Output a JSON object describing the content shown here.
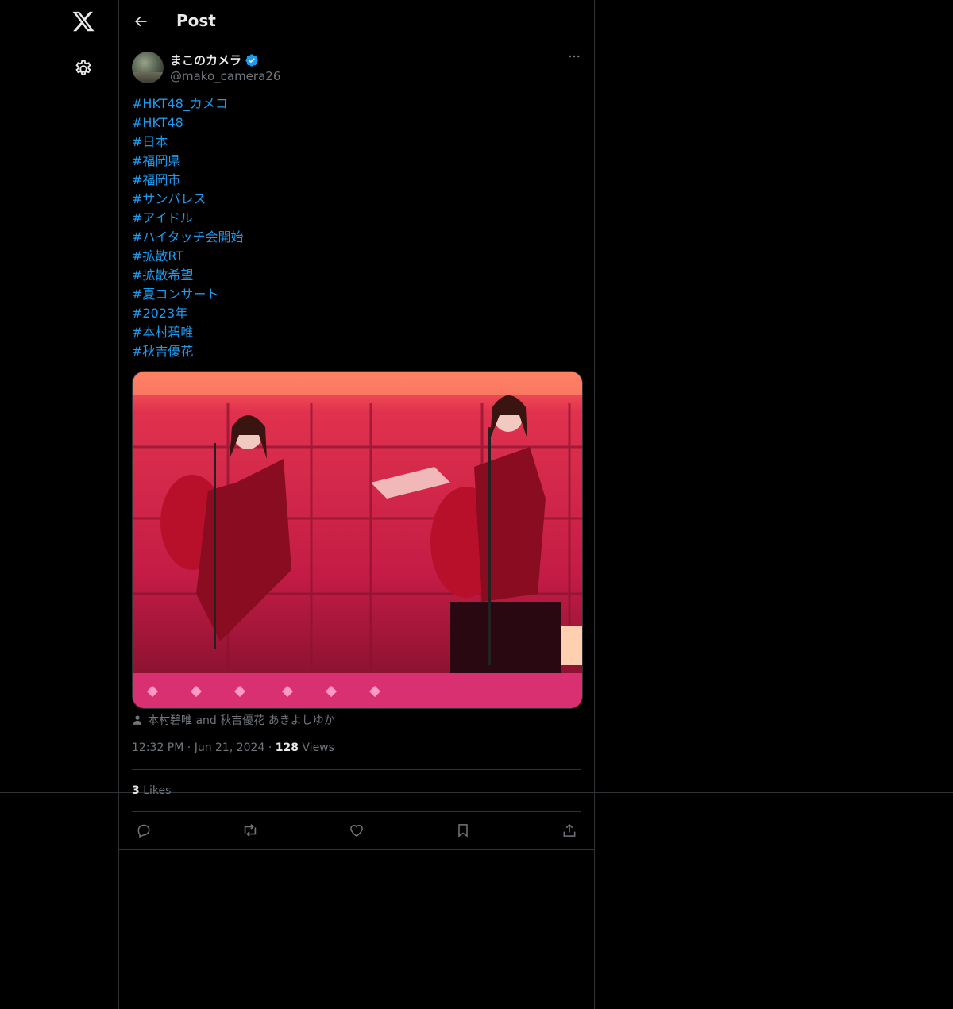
{
  "header": {
    "title": "Post"
  },
  "author": {
    "display_name": "まこのカメラ",
    "handle": "@mako_camera26",
    "verified": true
  },
  "post": {
    "hashtags": [
      "#HKT48_カメコ",
      "#HKT48",
      "#日本",
      "#福岡県",
      "#福岡市",
      "#サンパレス",
      "#アイドル",
      "#ハイタッチ会開始",
      "#拡散RT",
      "#拡散希望",
      "#夏コンサート",
      "#2023年",
      "#本村碧唯",
      "#秋吉優花"
    ],
    "tagged_people": "本村碧唯 and 秋吉優花 あきよしゆか",
    "time": "12:32 PM",
    "date": "Jun 21, 2024",
    "views_count": "128",
    "views_label": "Views",
    "likes_count": "3",
    "likes_label": "Likes"
  },
  "colors": {
    "accent": "#1d9bf0",
    "muted": "#71767b",
    "border": "#2f3336",
    "background": "#000000"
  },
  "icons": [
    "x-logo-icon",
    "gear-icon",
    "back-arrow-icon",
    "verified-badge-icon",
    "more-icon",
    "person-icon",
    "reply-icon",
    "repost-icon",
    "like-icon",
    "bookmark-icon",
    "share-icon"
  ]
}
